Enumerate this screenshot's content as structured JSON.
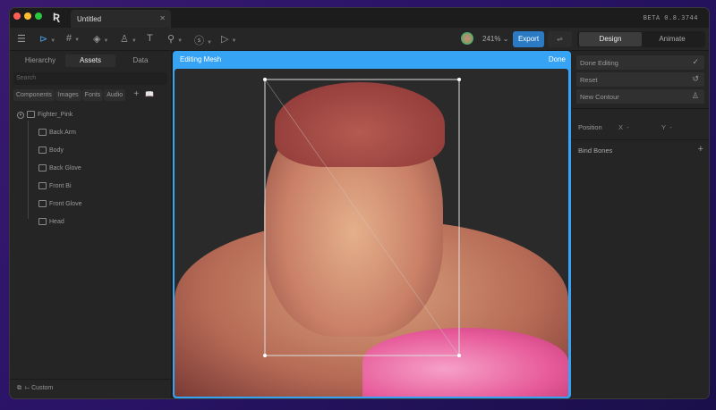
{
  "window": {
    "tab_title": "Untitled",
    "version": "BETA 0.8.3744"
  },
  "toolbar": {
    "zoom": "241%",
    "export_label": "Export",
    "modes": [
      "Design",
      "Animate"
    ]
  },
  "left": {
    "tabs": [
      "Hierarchy",
      "Assets",
      "Data"
    ],
    "search_placeholder": "Search",
    "filters": [
      "Components",
      "Images",
      "Fonts",
      "Audio"
    ],
    "root": "Fighter_Pink",
    "children": [
      "Back Arm",
      "Body",
      "Back Glove",
      "Front Bi",
      "Front Glove",
      "Head"
    ],
    "bottom_label": "Custom"
  },
  "canvas": {
    "title": "Editing Mesh",
    "done_label": "Done"
  },
  "right": {
    "buttons": [
      "Done Editing",
      "Reset",
      "New Contour"
    ],
    "position_label": "Position",
    "x_label": "X",
    "x_value": "-",
    "y_label": "Y",
    "y_value": "-",
    "bind_bones": "Bind Bones"
  }
}
